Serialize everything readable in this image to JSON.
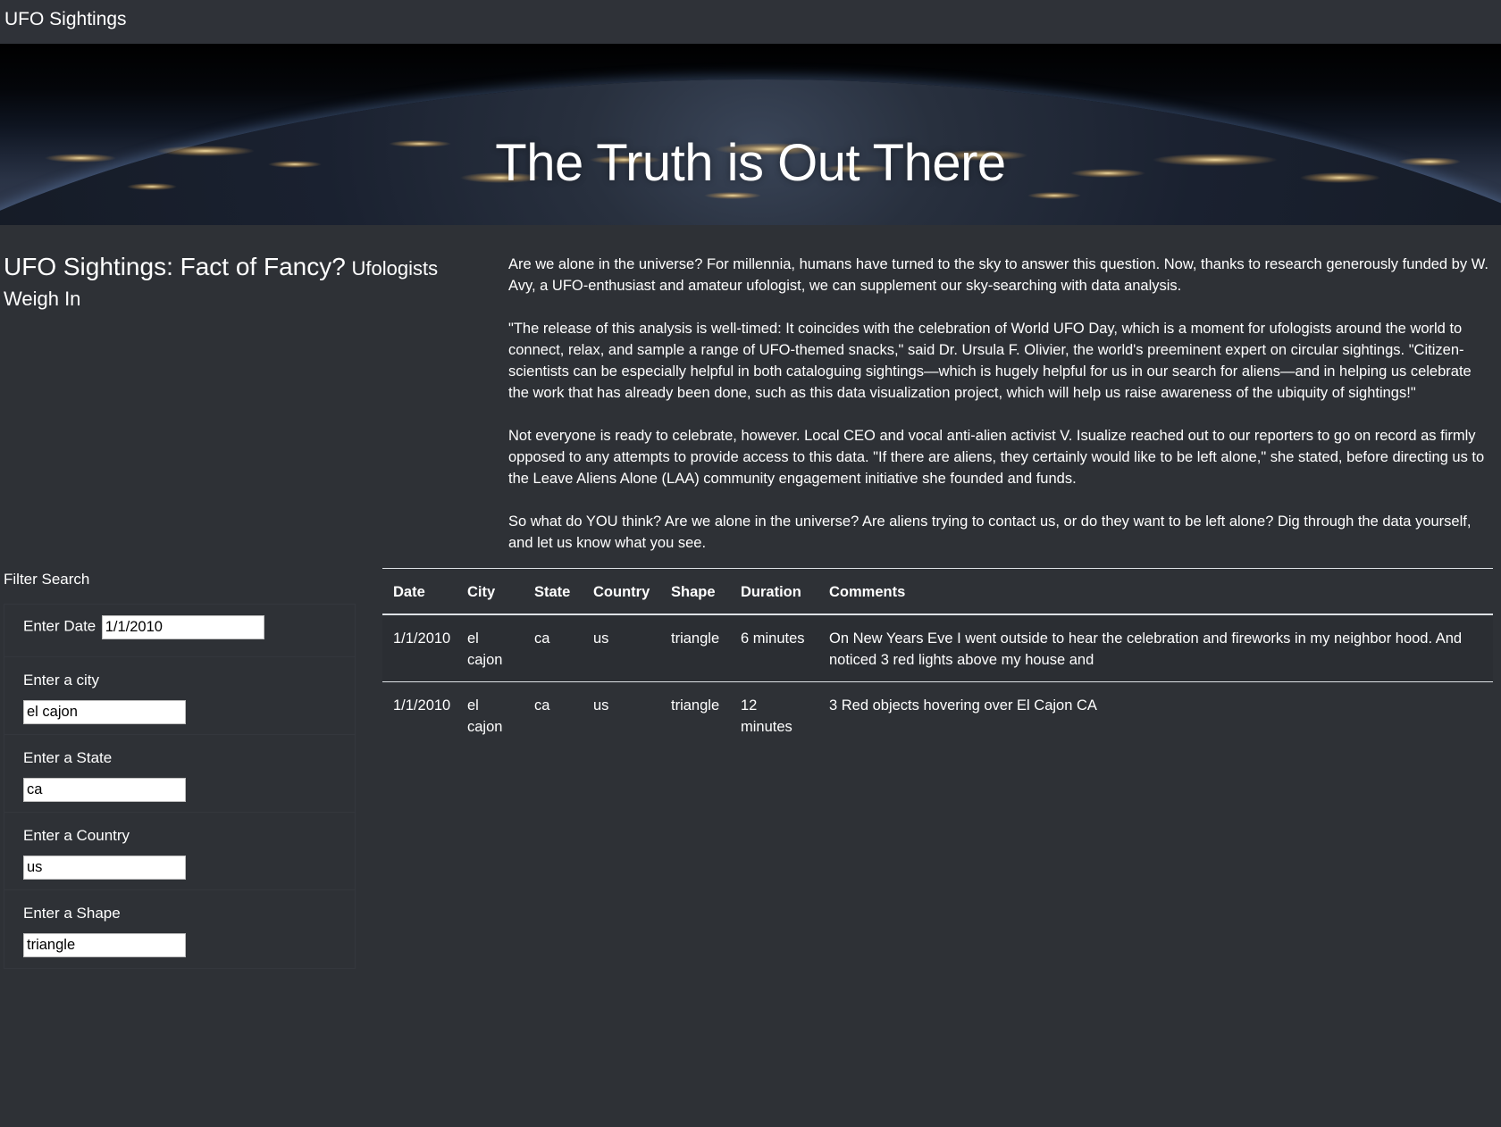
{
  "navbar": {
    "brand": "UFO Sightings"
  },
  "hero": {
    "title": "The Truth is Out There"
  },
  "headline": {
    "main": "UFO Sightings: Fact of Fancy?",
    "sub": "Ufologists Weigh In"
  },
  "article": {
    "paragraphs": [
      "Are we alone in the universe? For millennia, humans have turned to the sky to answer this question. Now, thanks to research generously funded by W. Avy, a UFO-enthusiast and amateur ufologist, we can supplement our sky-searching with data analysis.",
      "\"The release of this analysis is well-timed: It coincides with the celebration of World UFO Day, which is a moment for ufologists around the world to connect, relax, and sample a range of UFO-themed snacks,\" said Dr. Ursula F. Olivier, the world's preeminent expert on circular sightings. \"Citizen-scientists can be especially helpful in both cataloguing sightings—which is hugely helpful for us in our search for aliens—and in helping us celebrate the work that has already been done, such as this data visualization project, which will help us raise awareness of the ubiquity of sightings!\"",
      "Not everyone is ready to celebrate, however. Local CEO and vocal anti-alien activist V. Isualize reached out to our reporters to go on record as firmly opposed to any attempts to provide access to this data. \"If there are aliens, they certainly would like to be left alone,\" she stated, before directing us to the Leave Aliens Alone (LAA) community engagement initiative she founded and funds.",
      "So what do YOU think? Are we alone in the universe? Are aliens trying to contact us, or do they want to be left alone? Dig through the data yourself, and let us know what you see."
    ]
  },
  "filters": {
    "title": "Filter Search",
    "date": {
      "label": "Enter Date",
      "value": "1/1/2010"
    },
    "city": {
      "label": "Enter a city",
      "value": "el cajon"
    },
    "state": {
      "label": "Enter a State",
      "value": "ca"
    },
    "country": {
      "label": "Enter a Country",
      "value": "us"
    },
    "shape": {
      "label": "Enter a Shape",
      "value": "triangle"
    }
  },
  "table": {
    "headers": [
      "Date",
      "City",
      "State",
      "Country",
      "Shape",
      "Duration",
      "Comments"
    ],
    "rows": [
      [
        "1/1/2010",
        "el cajon",
        "ca",
        "us",
        "triangle",
        "6 minutes",
        "On New Years Eve I went outside to hear the celebration and fireworks in my neighbor hood. And noticed 3 red lights above my house and"
      ],
      [
        "1/1/2010",
        "el cajon",
        "ca",
        "us",
        "triangle",
        "12 minutes",
        "3 Red objects hovering over El Cajon CA"
      ]
    ]
  },
  "colors": {
    "background": "#2e3136",
    "navbar": "#2f3238",
    "text": "#ffffff",
    "table_rule": "#dee2e6"
  }
}
